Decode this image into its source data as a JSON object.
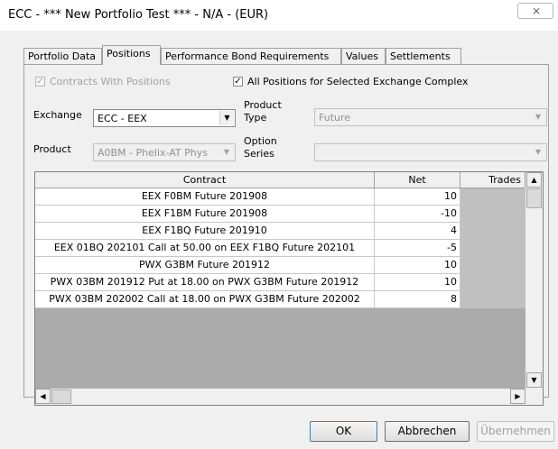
{
  "window": {
    "title": "ECC - *** New Portfolio Test *** - N/A - (EUR)",
    "close_glyph": "⨯"
  },
  "tabs": [
    {
      "label": "Portfolio Data",
      "active": false
    },
    {
      "label": "Positions",
      "active": true
    },
    {
      "label": "Performance Bond Requirements",
      "active": false
    },
    {
      "label": "Values",
      "active": false
    },
    {
      "label": "Settlements",
      "active": false
    }
  ],
  "filters": {
    "contracts_with_positions": {
      "label": "Contracts With Positions",
      "checked": true,
      "enabled": false
    },
    "all_positions": {
      "label": "All Positions for Selected Exchange Complex",
      "checked": true,
      "enabled": true
    },
    "exchange": {
      "label": "Exchange",
      "value": "ECC - EEX"
    },
    "product_type": {
      "label_line1": "Product",
      "label_line2": "Type",
      "value": "Future"
    },
    "product": {
      "label": "Product",
      "value": "A0BM -  Phelix-AT Phys"
    },
    "option_series": {
      "label_line1": "Option",
      "label_line2": "Series",
      "value": ""
    }
  },
  "grid": {
    "columns": [
      "Contract",
      "Net",
      "Trades"
    ],
    "rows": [
      {
        "contract": "EEX F0BM Future 201908",
        "net": "10"
      },
      {
        "contract": "EEX F1BM Future 201908",
        "net": "-10"
      },
      {
        "contract": "EEX F1BQ Future 201910",
        "net": "4"
      },
      {
        "contract": "EEX 01BQ 202101 Call at 50.00 on EEX F1BQ Future 202101",
        "net": "-5"
      },
      {
        "contract": "PWX G3BM Future 201912",
        "net": "10"
      },
      {
        "contract": "PWX 03BM 201912 Put at 18.00 on PWX G3BM Future 201912",
        "net": "10"
      },
      {
        "contract": "PWX 03BM 202002 Call at 18.00 on PWX G3BM Future 202002",
        "net": "8"
      }
    ]
  },
  "buttons": {
    "ok": "OK",
    "cancel": "Abbrechen",
    "apply": "Übernehmen"
  },
  "colors": {
    "dialog_bg": "#f0f0f0",
    "grid_empty": "#ababab",
    "trades_cell": "#c0c0c0",
    "default_button_border": "#3c7fb1"
  }
}
